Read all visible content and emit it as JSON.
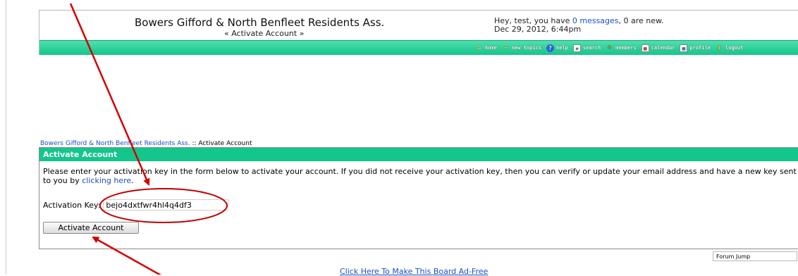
{
  "header": {
    "site_title": "Bowers Gifford & North Benfleet Residents Ass.",
    "page_subtitle": "« Activate Account »",
    "greeting_prefix": "Hey, test, you have ",
    "messages_link": "0 messages",
    "greeting_suffix": ", 0 are new.",
    "datetime": "Dec 29, 2012, 6:44pm"
  },
  "nav": {
    "items": [
      {
        "label": "home",
        "icon": "home-icon"
      },
      {
        "label": "new topics",
        "icon": "star-icon"
      },
      {
        "label": "help",
        "icon": "help-icon"
      },
      {
        "label": "search",
        "icon": "search-icon"
      },
      {
        "label": "members",
        "icon": "members-icon"
      },
      {
        "label": "calendar",
        "icon": "calendar-icon"
      },
      {
        "label": "profile",
        "icon": "profile-icon"
      },
      {
        "label": "logout",
        "icon": "logout-icon"
      }
    ]
  },
  "breadcrumb": {
    "forum_link": "Bowers Gifford & North Benfleet Residents Ass.",
    "separator": " :: ",
    "current": "Activate Account"
  },
  "panel": {
    "title": "Activate Account",
    "text_before_link": "Please enter your activation key in the form below to activate your account. If you did not receive your activation key, then you can verify or update your email address and have a new key sent to you by ",
    "link_text": "clicking here",
    "text_after_link": ".",
    "key_label": "Activation Key:",
    "key_value": "bejo4dxtfwr4hl4q4df3",
    "button_label": "Activate Account"
  },
  "footer": {
    "forum_jump": "Forum Jump",
    "adfree_link": "Click Here To Make This Board Ad-Free"
  },
  "colors": {
    "accent_green": "#14c58c",
    "link_blue": "#1a4fbf",
    "annotation_red": "#d40000"
  }
}
